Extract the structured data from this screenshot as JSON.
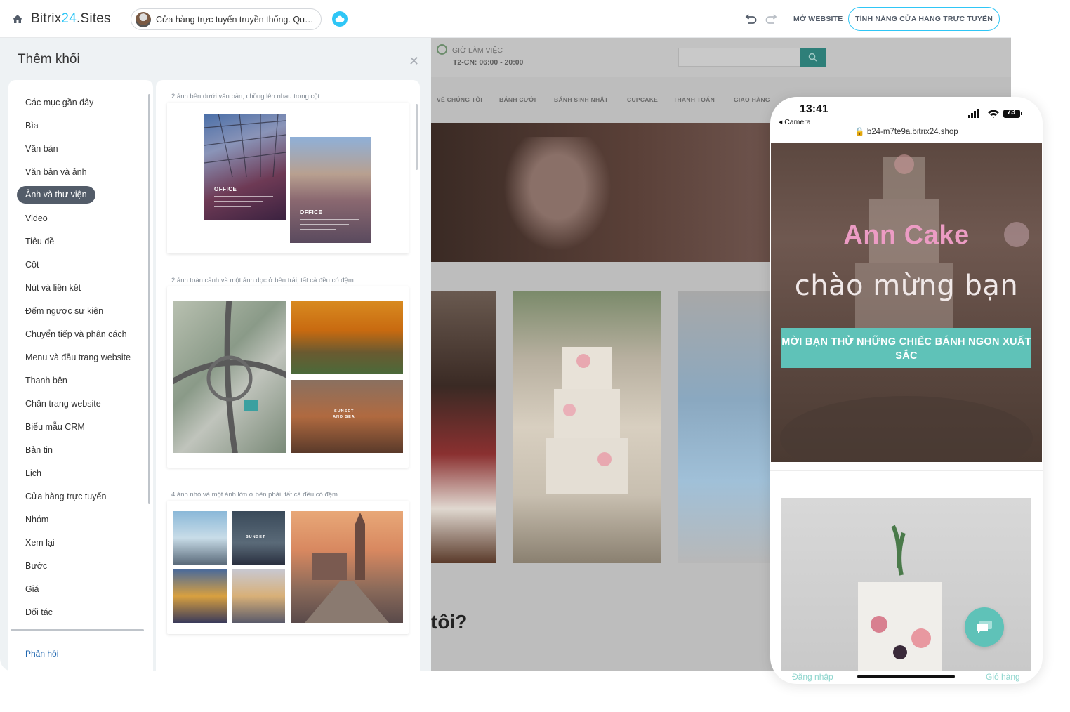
{
  "topbar": {
    "brand_prefix": "Bitrix",
    "brand_num": "24",
    "brand_suffix": ".Sites",
    "site_name": "Cửa hàng trực tuyến truyền thống. Quả...",
    "open_website": "MỞ WEBSITE",
    "store_features": "TÍNH NĂNG CỬA HÀNG TRỰC TUYẾN",
    "icons": [
      "home-icon",
      "cloud-icon",
      "undo-icon",
      "redo-icon"
    ]
  },
  "panel": {
    "title": "Thêm khối",
    "categories": [
      "Các mục gần đây",
      "Bìa",
      "Văn bản",
      "Văn bản và ảnh",
      "Ảnh và thư viện",
      "Video",
      "Tiêu đề",
      "Cột",
      "Nút và liên kết",
      "Đếm ngược sự kiện",
      "Chuyển tiếp và phân cách",
      "Menu và đầu trang website",
      "Thanh bên",
      "Chân trang website",
      "Biểu mẫu CRM",
      "Bản tin",
      "Lịch",
      "Cửa hàng trực tuyến",
      "Nhóm",
      "Xem lại",
      "Bước",
      "Giá",
      "Đối tác"
    ],
    "active_category": "Ảnh và thư viện",
    "feedback": "Phản hồi",
    "blocks": [
      {
        "label": "2 ảnh bên dưới văn bản, chồng lên nhau trong cột",
        "captions": [
          "OFFICE",
          "OFFICE"
        ]
      },
      {
        "label": "2 ảnh toàn cảnh và một ảnh dọc ở bên trái, tất cả đều có đệm",
        "captions": [
          "SUNSET",
          "AND SEA"
        ]
      },
      {
        "label": "4 ảnh nhỏ và một ảnh lớn ở bên phải, tất cả đều có đệm",
        "captions": [
          "SUNSET"
        ]
      }
    ]
  },
  "preview": {
    "hours_title": "GIỜ LÀM VIỆC",
    "hours": "T2-CN: 06:00 - 20:00",
    "nav": [
      "VỀ CHÚNG TÔI",
      "BÁNH CƯỚI",
      "BÁNH SINH NHẬT",
      "CUPCAKE",
      "THANH TOÁN",
      "GIAO HÀNG"
    ],
    "bottom_text": "tôi?"
  },
  "phone": {
    "time": "13:41",
    "camera": "◂ Camera",
    "battery": "73",
    "url": "b24-m7te9a.bitrix24.shop",
    "brand": "Ann Cake",
    "welcome": "chào mừng bạn",
    "cta": "MỜI BẠN THỬ NHỮNG CHIẾC BÁNH NGON XUẤT SẮC",
    "login": "Đăng nhập",
    "cart": "Giỏ hàng"
  },
  "colors": {
    "accent": "#2fc6f6",
    "teal": "#5fc2b8",
    "brand_pink": "#ec9cc4",
    "active_bg": "#535c69"
  }
}
